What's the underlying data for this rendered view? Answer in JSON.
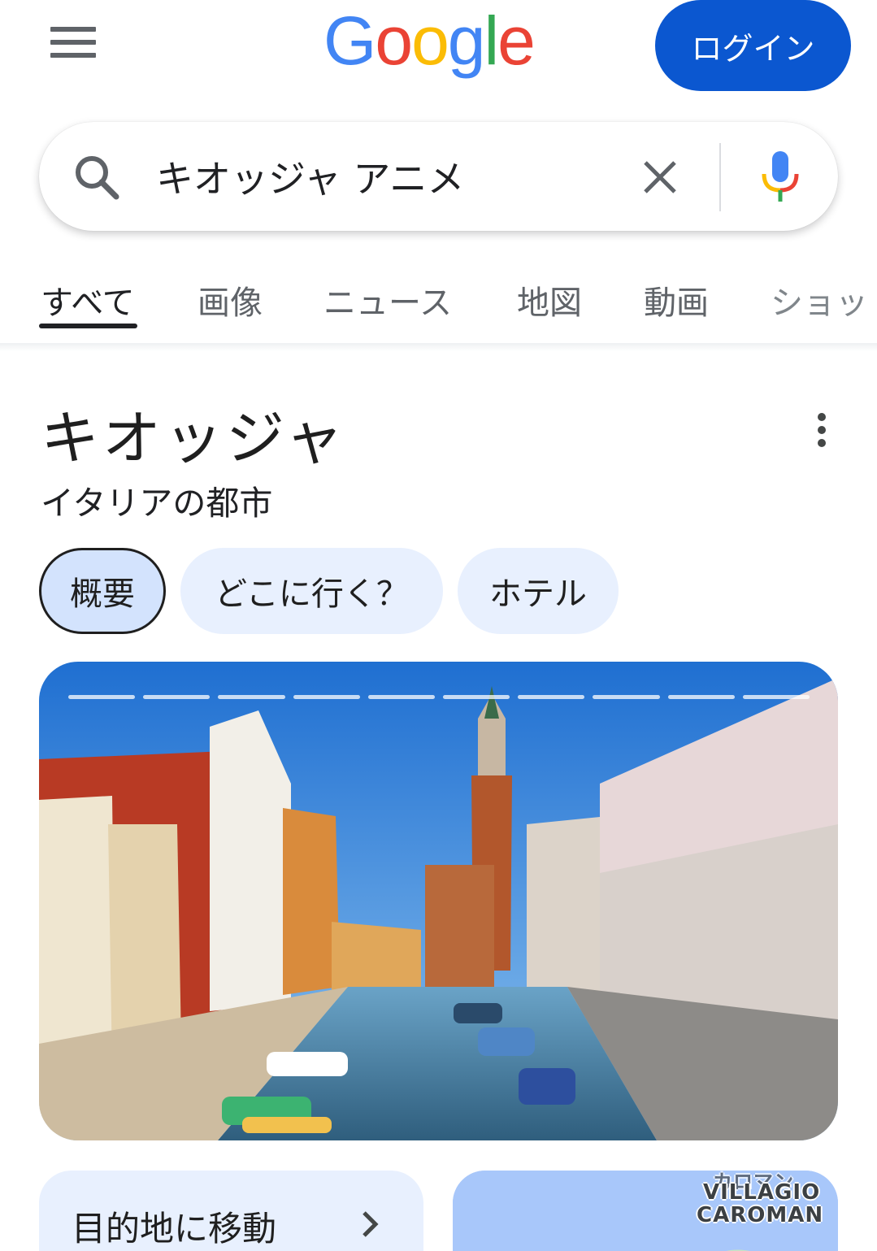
{
  "header": {
    "menu_icon": "hamburger-menu-icon",
    "logo_letters": [
      {
        "char": "G",
        "color": "#4285F4"
      },
      {
        "char": "o",
        "color": "#EA4335"
      },
      {
        "char": "o",
        "color": "#FBBC05"
      },
      {
        "char": "g",
        "color": "#4285F4"
      },
      {
        "char": "l",
        "color": "#34A853"
      },
      {
        "char": "e",
        "color": "#EA4335"
      }
    ],
    "login_label": "ログイン"
  },
  "search": {
    "query": "キオッジャ アニメ",
    "search_icon": "search-icon",
    "clear_icon": "close-icon",
    "mic_icon": "microphone-icon"
  },
  "tabs": [
    {
      "label": "すべて",
      "active": true
    },
    {
      "label": "画像"
    },
    {
      "label": "ニュース"
    },
    {
      "label": "地図"
    },
    {
      "label": "動画"
    },
    {
      "label": "ショッ"
    }
  ],
  "knowledge_panel": {
    "title": "キオッジャ",
    "subtitle": "イタリアの都市",
    "more_icon": "more-vert-icon",
    "chips": [
      {
        "label": "概要",
        "selected": true
      },
      {
        "label": "どこに行く？"
      },
      {
        "label": "ホテル"
      }
    ],
    "photo": {
      "description_icon": "canal-photo",
      "slides_total": 10,
      "slide_current": 1
    },
    "destination_card": {
      "label": "目的地に移動",
      "icon": "chevron-right-icon"
    },
    "map_card": {
      "label_line1": "VILLAGIO",
      "label_line2": "CAROMAN",
      "partial_top": "カロマン"
    }
  },
  "colors": {
    "accent": "#0b57d0",
    "chip_bg": "#e8f0fe",
    "chip_selected_bg": "#d3e3fd",
    "map_water": "#a8c7fa"
  }
}
